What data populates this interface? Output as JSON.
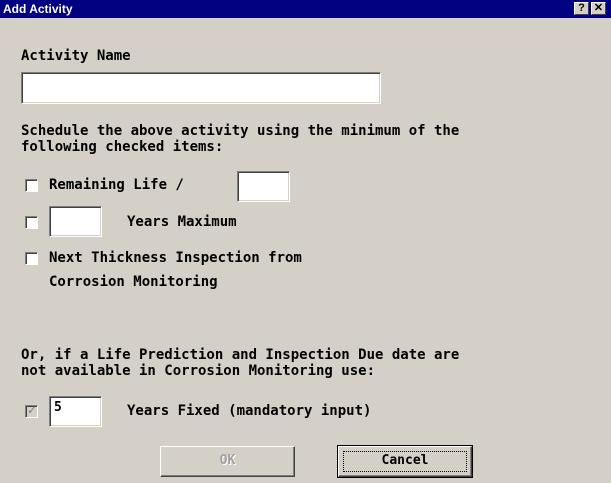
{
  "window": {
    "title": "Add Activity",
    "help_glyph": "?",
    "close_glyph": "✕"
  },
  "activity_name": {
    "label": "Activity Name",
    "value": ""
  },
  "schedule": {
    "instruction_line1": "Schedule the above activity using the minimum of the",
    "instruction_line2": "following checked items:",
    "remaining_life": {
      "label": "Remaining Life /",
      "checked": false,
      "value": ""
    },
    "years_max": {
      "label": "Years Maximum",
      "checked": false,
      "value": ""
    },
    "next_inspection": {
      "label_line1": "Next Thickness Inspection from",
      "label_line2": "Corrosion Monitoring",
      "checked": false
    }
  },
  "fallback": {
    "line1": "Or, if a Life Prediction and Inspection Due date are",
    "line2": "not available in Corrosion Monitoring use:",
    "years_fixed": {
      "label": "Years Fixed (mandatory input)",
      "checked": true,
      "enabled": false,
      "value": "5"
    }
  },
  "buttons": {
    "ok": "OK",
    "cancel": "Cancel"
  }
}
